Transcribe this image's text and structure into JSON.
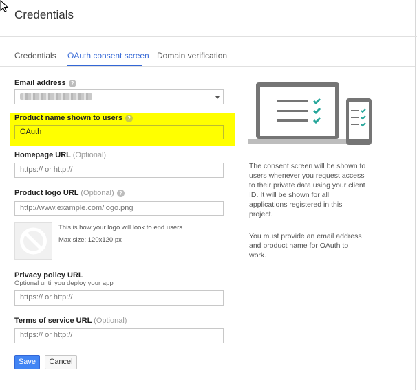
{
  "header": {
    "title": "Credentials"
  },
  "tabs": [
    {
      "label": "Credentials",
      "active": false
    },
    {
      "label": "OAuth consent screen",
      "active": true
    },
    {
      "label": "Domain verification",
      "active": false
    }
  ],
  "form": {
    "email": {
      "label": "Email address"
    },
    "product_name": {
      "label": "Product name shown to users",
      "value": "OAuth"
    },
    "homepage": {
      "label": "Homepage URL",
      "optional": "(Optional)",
      "placeholder": "https:// or http://"
    },
    "logo": {
      "label": "Product logo URL",
      "optional": "(Optional)",
      "placeholder": "http://www.example.com/logo.png",
      "preview_caption": "This is how your logo will look to end users",
      "max_size": "Max size: 120x120 px"
    },
    "privacy": {
      "label": "Privacy policy URL",
      "sublabel": "Optional until you deploy your app",
      "placeholder": "https:// or http://"
    },
    "terms": {
      "label": "Terms of service URL",
      "optional": "(Optional)",
      "placeholder": "https:// or http://"
    }
  },
  "actions": {
    "save": "Save",
    "cancel": "Cancel"
  },
  "info": {
    "lines_1": [
      "The consent screen will be shown to",
      "users whenever you request access",
      "to their private data using your client",
      "ID. It will be shown for all",
      "applications registered in this",
      "project."
    ],
    "lines_2": [
      "You must provide an email address",
      "and product name for OAuth to",
      "work."
    ]
  },
  "colors": {
    "accent": "#3367d6",
    "primary_button": "#4285f4",
    "highlight": "#ffff00",
    "illustration_check": "#26a69a"
  },
  "icons": {
    "help": "question-circle-icon",
    "dropdown": "chevron-down-icon",
    "no_logo": "no-image-icon"
  }
}
